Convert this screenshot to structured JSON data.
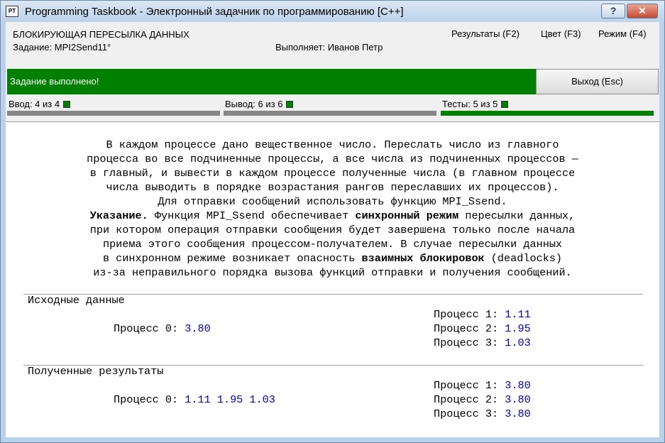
{
  "window": {
    "icon_text": "PT",
    "title": "Programming Taskbook - Электронный задачник по программированию [C++]",
    "help_label": "?",
    "close_label": "✕"
  },
  "header": {
    "title": "БЛОКИРУЮЩАЯ ПЕРЕСЫЛКА ДАННЫХ",
    "task": "Задание: MPI2Send11°",
    "user": "Выполняет: Иванов Петр"
  },
  "menu": {
    "results": "Результаты (F2)",
    "color": "Цвет (F3)",
    "mode": "Режим (F4)"
  },
  "status": {
    "message": "Задание выполнено!",
    "exit_label": "Выход (Esc)",
    "color": "#008000"
  },
  "progress": [
    {
      "label": "Ввод: 4 из 4",
      "fraction": 0
    },
    {
      "label": "Вывод: 6 из 6",
      "fraction": 0
    },
    {
      "label": "Тесты: 5 из 5",
      "fraction": 1
    }
  ],
  "description": {
    "lines": [
      "В каждом процессе дано вещественное число. Переслать число из главного",
      "процесса во все подчиненные процессы, а все числа из подчиненных процессов —",
      "в главный, и вывести в каждом процессе полученные числа (в главном процессе",
      "числа выводить в порядке возрастания рангов переславших их процессов).",
      "Для отправки сообщений использовать функцию MPI_Ssend."
    ],
    "hint_bold": "Указание.",
    "hint_text1": " Функция MPI_Ssend обеспечивает ",
    "hint_bold2": "синхронный режим",
    "hint_text2": " пересылки данных,",
    "hint_lines": [
      "при котором операция отправки сообщения будет завершена только после начала",
      "приема этого сообщения процессом-получателем. В случае пересылки данных"
    ],
    "hint_text3": "в синхронном режиме возникает опасность ",
    "hint_bold3": "взаимных блокировок",
    "hint_text4": " (deadlocks)",
    "hint_last": "из-за неправильного порядка вызова функций отправки и получения сообщений."
  },
  "input": {
    "heading": "Исходные данные",
    "p0_label": "Процесс 0:",
    "p0_value": "3.80",
    "p1_label": "Процесс 1:",
    "p1_value": "1.11",
    "p2_label": "Процесс 2:",
    "p2_value": "1.95",
    "p3_label": "Процесс 3:",
    "p3_value": "1.03"
  },
  "output": {
    "heading": "Полученные результаты",
    "p0_label": "Процесс 0:",
    "p0_value": "1.11 1.95 1.03",
    "p1_label": "Процесс 1:",
    "p1_value": "3.80",
    "p2_label": "Процесс 2:",
    "p2_value": "3.80",
    "p3_label": "Процесс 3:",
    "p3_value": "3.80"
  }
}
